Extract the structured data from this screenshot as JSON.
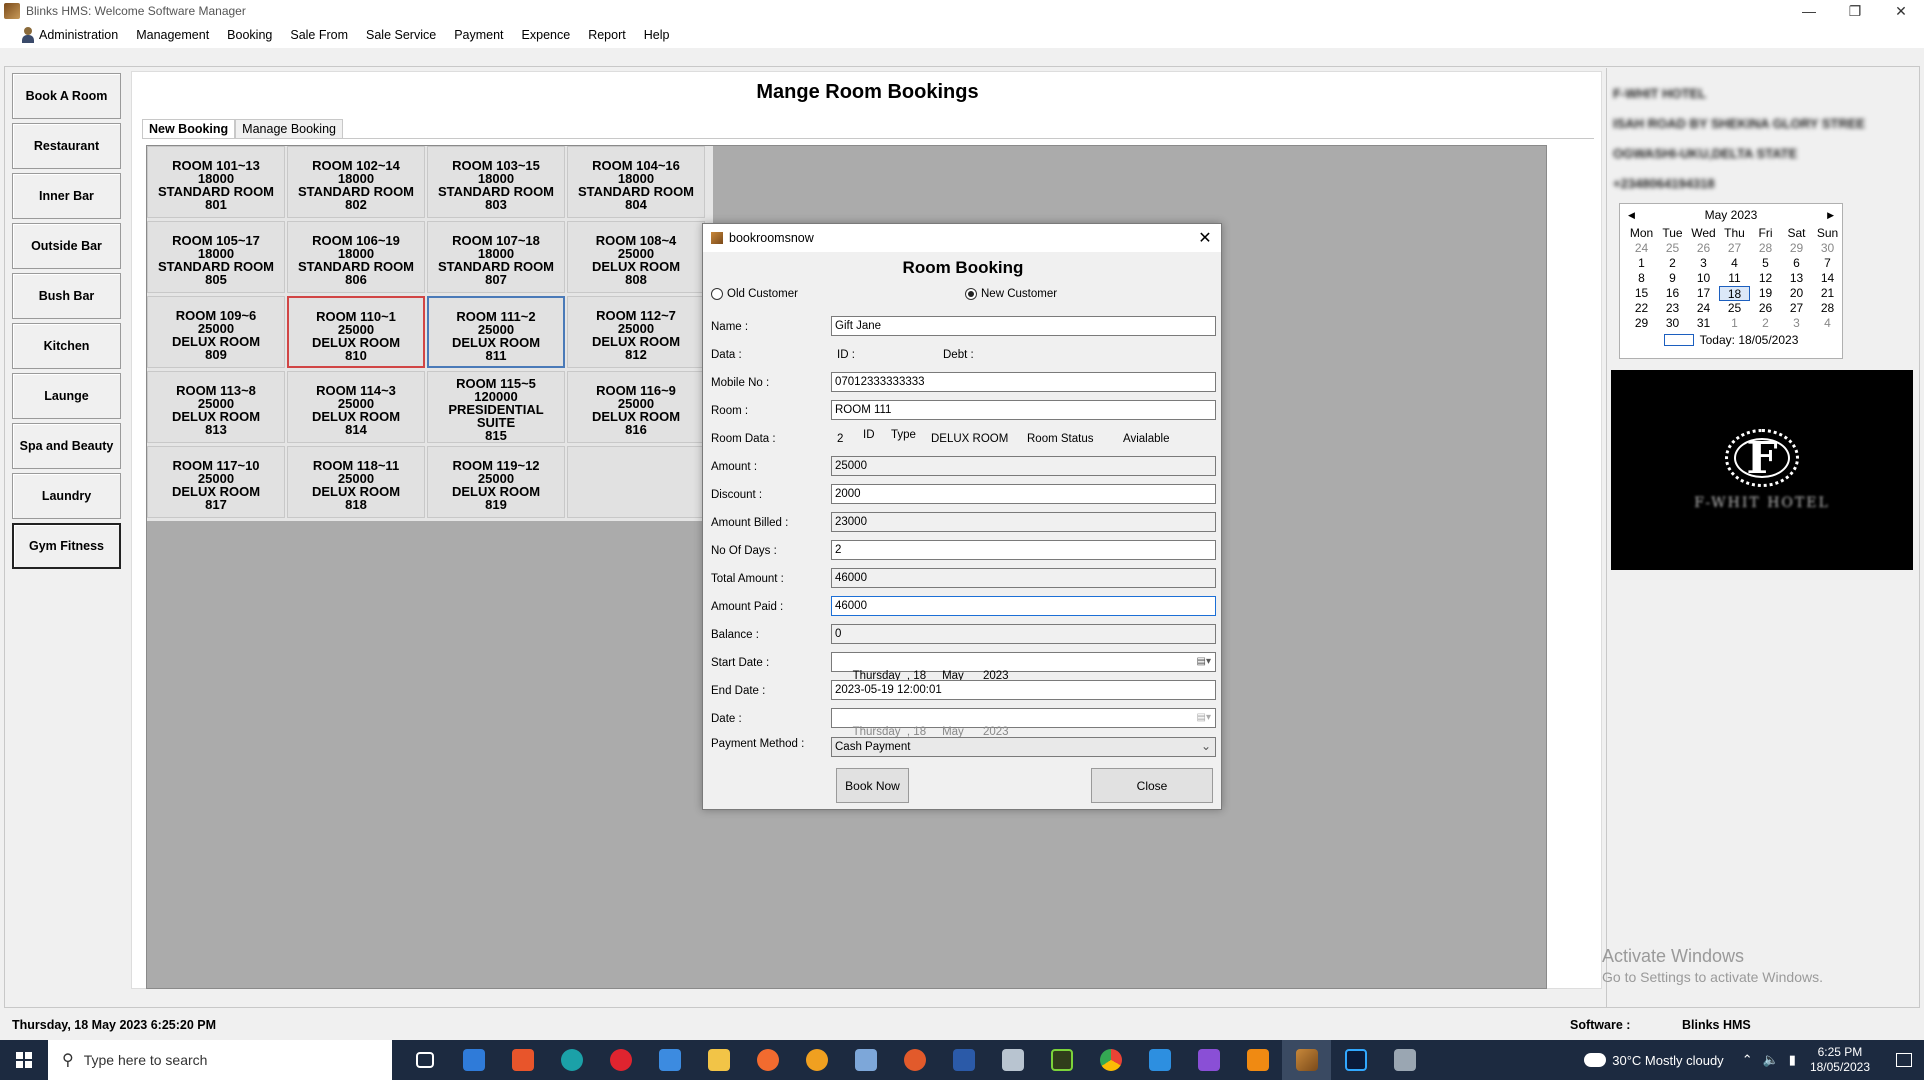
{
  "window": {
    "title": "Blinks HMS: Welcome Software Manager"
  },
  "menu": [
    "Administration",
    "Management",
    "Booking",
    "Sale From",
    "Sale Service",
    "Payment",
    "Expence",
    "Report",
    "Help"
  ],
  "sidebar": [
    "Book A Room",
    "Restaurant",
    "Inner Bar",
    "Outside Bar",
    "Bush Bar",
    "Kitchen",
    "Launge",
    "Spa and Beauty",
    "Laundry",
    "Gym  Fitness"
  ],
  "page": {
    "title": "Mange Room Bookings",
    "tabs": [
      "New Booking",
      "Manage Booking"
    ]
  },
  "rooms": [
    {
      "l1": "ROOM 101~13",
      "l2": "18000",
      "l3": "STANDARD ROOM",
      "l4": "801"
    },
    {
      "l1": "ROOM 102~14",
      "l2": "18000",
      "l3": "STANDARD ROOM",
      "l4": "802"
    },
    {
      "l1": "ROOM 103~15",
      "l2": "18000",
      "l3": "STANDARD ROOM",
      "l4": "803"
    },
    {
      "l1": "ROOM 104~16",
      "l2": "18000",
      "l3": "STANDARD ROOM",
      "l4": "804"
    },
    {
      "l1": "ROOM 105~17",
      "l2": "18000",
      "l3": "STANDARD ROOM",
      "l4": "805"
    },
    {
      "l1": "ROOM 106~19",
      "l2": "18000",
      "l3": "STANDARD ROOM",
      "l4": "806"
    },
    {
      "l1": "ROOM 107~18",
      "l2": "18000",
      "l3": "STANDARD ROOM",
      "l4": "807"
    },
    {
      "l1": "ROOM 108~4",
      "l2": "25000",
      "l3": "DELUX ROOM",
      "l4": "808"
    },
    {
      "l1": "ROOM 109~6",
      "l2": "25000",
      "l3": "DELUX ROOM",
      "l4": "809"
    },
    {
      "l1": "ROOM 110~1",
      "l2": "25000",
      "l3": "DELUX ROOM",
      "l4": "810"
    },
    {
      "l1": "ROOM 111~2",
      "l2": "25000",
      "l3": "DELUX ROOM",
      "l4": "811"
    },
    {
      "l1": "ROOM 112~7",
      "l2": "25000",
      "l3": "DELUX ROOM",
      "l4": "812"
    },
    {
      "l1": "ROOM 113~8",
      "l2": "25000",
      "l3": "DELUX ROOM",
      "l4": "813"
    },
    {
      "l1": "ROOM 114~3",
      "l2": "25000",
      "l3": "DELUX ROOM",
      "l4": "814"
    },
    {
      "l1": "ROOM 115~5",
      "l2": "120000",
      "l3": "PRESIDENTIAL SUITE",
      "l4": "815"
    },
    {
      "l1": "ROOM 116~9",
      "l2": "25000",
      "l3": "DELUX ROOM",
      "l4": "816"
    },
    {
      "l1": "ROOM 117~10",
      "l2": "25000",
      "l3": "DELUX ROOM",
      "l4": "817"
    },
    {
      "l1": "ROOM 118~11",
      "l2": "25000",
      "l3": "DELUX ROOM",
      "l4": "818"
    },
    {
      "l1": "ROOM 119~12",
      "l2": "25000",
      "l3": "DELUX ROOM",
      "l4": "819"
    }
  ],
  "hotel": {
    "name": "F-WHIT HOTEL",
    "address1": "ISAH ROAD BY SHEKINA GLORY STREE",
    "address2": "OGWASHI-UKU,DELTA STATE",
    "phone": "+2348064194318"
  },
  "calendar": {
    "month": "May 2023",
    "weekdays": [
      "Mon",
      "Tue",
      "Wed",
      "Thu",
      "Fri",
      "Sat",
      "Sun"
    ],
    "days": [
      "24",
      "25",
      "26",
      "27",
      "28",
      "29",
      "30",
      "1",
      "2",
      "3",
      "4",
      "5",
      "6",
      "7",
      "8",
      "9",
      "10",
      "11",
      "12",
      "13",
      "14",
      "15",
      "16",
      "17",
      "18",
      "19",
      "20",
      "21",
      "22",
      "23",
      "24",
      "25",
      "26",
      "27",
      "28",
      "29",
      "30",
      "31",
      "1",
      "2",
      "3",
      "4"
    ],
    "today_label": "Today: 18/05/2023"
  },
  "logo": {
    "name": "F-WHIT HOTEL"
  },
  "watermark": {
    "line1": "Activate Windows",
    "line2": "Go to Settings to activate Windows."
  },
  "status": {
    "datetime": "Thursday, 18 May 2023 6:25:20 PM",
    "software_label": "Software :",
    "software_name": "Blinks HMS"
  },
  "dialog": {
    "window_title": "bookroomsnow",
    "heading": "Room Booking",
    "old_customer": "Old Customer",
    "new_customer": "New Customer",
    "labels": {
      "name": "Name :",
      "data": "Data :",
      "id": "ID :",
      "debt": "Debt :",
      "mobile": "Mobile No :",
      "room": "Room :",
      "room_data": "Room Data :",
      "amount": "Amount :",
      "discount": "Discount :",
      "amount_billed": "Amount Billed :",
      "no_of_days": "No Of Days :",
      "total_amount": "Total Amount :",
      "amount_paid": "Amount Paid :",
      "balance": "Balance :",
      "start_date": "Start Date :",
      "end_date": "End Date :",
      "date": "Date :",
      "payment_method": "Payment Method :"
    },
    "room_data": {
      "num": "2",
      "id": "ID",
      "type": "Type",
      "type_val": "DELUX ROOM",
      "status": "Room Status",
      "status_val": "Avialable"
    },
    "values": {
      "name": "Gift Jane",
      "mobile": "07012333333333",
      "room": "ROOM 111",
      "amount": "25000",
      "discount": "2000",
      "amount_billed": "23000",
      "no_of_days": "2",
      "total_amount": "46000",
      "amount_paid": "46000",
      "balance": "0",
      "start_date": "Thursday  , 18     May      2023",
      "end_date": "2023-05-19 12:00:01",
      "date": "Thursday  , 18     May      2023",
      "payment_method": "Cash Payment"
    },
    "book_now": "Book Now",
    "close": "Close"
  },
  "taskbar": {
    "search_placeholder": "Type here to search",
    "weather": "30°C  Mostly cloudy",
    "time": "6:25 PM",
    "date": "18/05/2023"
  }
}
